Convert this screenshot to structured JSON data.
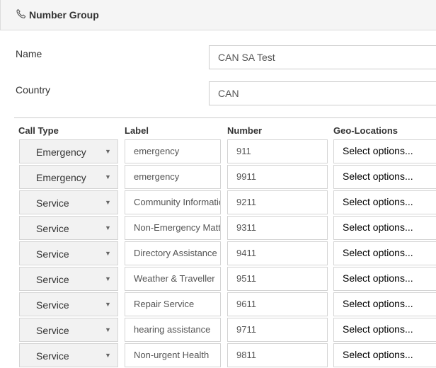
{
  "header": {
    "title": "Number Group",
    "icon": "phone-icon"
  },
  "form": {
    "name_label": "Name",
    "name_value": "CAN SA Test",
    "country_label": "Country",
    "country_value": "CAN"
  },
  "table": {
    "columns": {
      "call_type": "Call Type",
      "label": "Label",
      "number": "Number",
      "geo": "Geo-Locations"
    },
    "rows": [
      {
        "call_type": "Emergency",
        "label": "emergency",
        "number": "911",
        "geo": "Select options..."
      },
      {
        "call_type": "Emergency",
        "label": "emergency",
        "number": "9911",
        "geo": "Select options..."
      },
      {
        "call_type": "Service",
        "label": "Community Information",
        "number": "9211",
        "geo": "Select options..."
      },
      {
        "call_type": "Service",
        "label": "Non-Emergency Matters",
        "number": "9311",
        "geo": "Select options..."
      },
      {
        "call_type": "Service",
        "label": "Directory Assistance",
        "number": "9411",
        "geo": "Select options..."
      },
      {
        "call_type": "Service",
        "label": "Weather & Traveller",
        "number": "9511",
        "geo": "Select options..."
      },
      {
        "call_type": "Service",
        "label": "Repair Service",
        "number": "9611",
        "geo": "Select options..."
      },
      {
        "call_type": "Service",
        "label": "hearing assistance",
        "number": "9711",
        "geo": "Select options..."
      },
      {
        "call_type": "Service",
        "label": "Non-urgent Health",
        "number": "9811",
        "geo": "Select options..."
      }
    ]
  }
}
